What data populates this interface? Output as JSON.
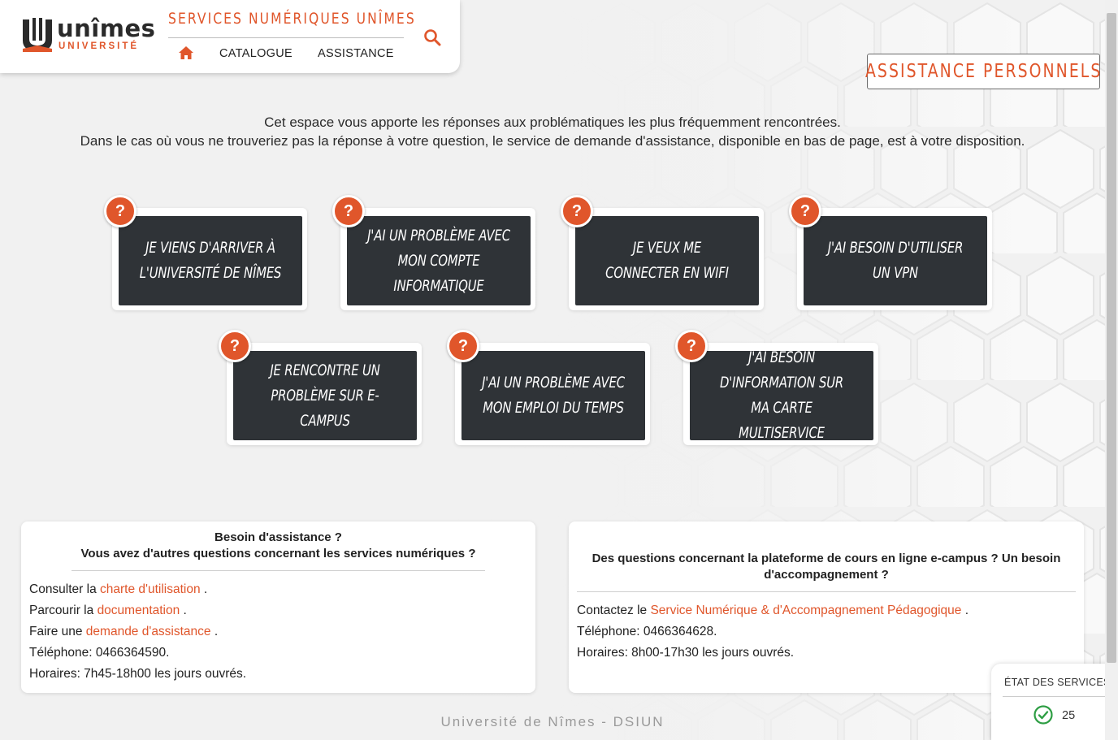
{
  "brand": {
    "logo_word": "unîmes",
    "logo_sub": "UNIVERSITÉ",
    "site_title": "SERVICES NUMÉRIQUES UNÎMES",
    "accent_color": "#e0562b"
  },
  "nav": {
    "home_icon": "home-icon",
    "items": [
      "CATALOGUE",
      "ASSISTANCE"
    ],
    "search_icon": "search-icon"
  },
  "assistance_button": "ASSISTANCE PERSONNELS",
  "intro": {
    "line1": "Cet espace vous apporte les réponses aux problématiques les plus fréquemment rencontrées.",
    "line2": "Dans le cas où vous ne trouveriez pas la réponse à votre question, le service de demande d'assistance, disponible en bas de page, est à votre disposition."
  },
  "cards": [
    {
      "icon": "question-mark-icon",
      "label": "Je viens d'arriver à l'Université de Nîmes"
    },
    {
      "icon": "question-mark-icon",
      "label": "J'ai un problème avec mon compte informatique"
    },
    {
      "icon": "question-mark-icon",
      "label": "Je veux me connecter en wifi"
    },
    {
      "icon": "question-mark-icon",
      "label": "J'ai besoin d'utiliser un VPN"
    },
    {
      "icon": "question-mark-icon",
      "label": "Je rencontre un problème sur e-campus"
    },
    {
      "icon": "question-mark-icon",
      "label": "J'ai un problème avec mon emploi du temps"
    },
    {
      "icon": "question-mark-icon",
      "label": "J'ai besoin d'information sur ma carte multiservice"
    }
  ],
  "info_left": {
    "head1": "Besoin d'assistance ?",
    "head2": "Vous avez d'autres questions concernant les services numériques ?",
    "l1_pre": "Consulter la ",
    "l1_link": "charte d'utilisation",
    "l1_post": " .",
    "l2_pre": "Parcourir la ",
    "l2_link": "documentation",
    "l2_post": " .",
    "l3_pre": "Faire une ",
    "l3_link": "demande d'assistance",
    "l3_post": " .",
    "phone": "Téléphone: 0466364590.",
    "hours": "Horaires: 7h45-18h00 les jours ouvrés."
  },
  "info_right": {
    "head1": "Des questions concernant la plateforme de cours en ligne e-campus ? Un besoin",
    "head2": "d'accompagnement ?",
    "l1_pre": "Contactez le ",
    "l1_link": "Service Numérique & d'Accompagnement Pédagogique",
    "l1_post": "  .",
    "phone": "Téléphone: 0466364628.",
    "hours": "Horaires: 8h00-17h30 les jours ouvrés."
  },
  "footer": "Université de Nîmes - DSIUN",
  "status": {
    "title": "ÉTAT DES SERVICES",
    "icon": "check-circle-icon",
    "count": "25",
    "ok_color": "#2e9e44"
  }
}
